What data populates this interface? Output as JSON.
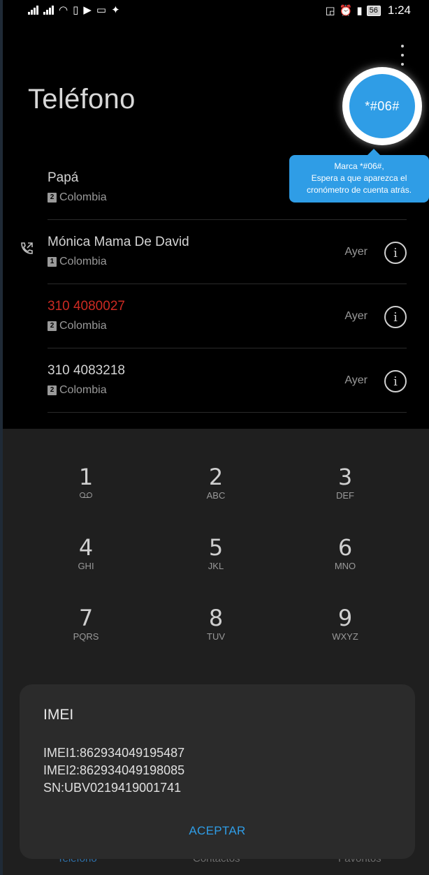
{
  "status_bar": {
    "battery": "56",
    "time": "1:24"
  },
  "app": {
    "title": "Teléfono"
  },
  "highlight": {
    "code": "*#06#",
    "tooltip": [
      "Marca *#06#,",
      "Espera a que aparezca el",
      "cronómetro de cuenta atrás."
    ]
  },
  "call_log": [
    {
      "name": "Papá",
      "sim": "2",
      "location": "Colombia",
      "when": "",
      "missed": false
    },
    {
      "name": "Mónica Mama De David",
      "sim": "1",
      "location": "Colombia",
      "when": "Ayer",
      "missed": false
    },
    {
      "name": "310 4080027",
      "sim": "2",
      "location": "Colombia",
      "when": "Ayer",
      "missed": true
    },
    {
      "name": "310 4083218",
      "sim": "2",
      "location": "Colombia",
      "when": "Ayer",
      "missed": false
    }
  ],
  "dialpad": [
    {
      "digit": "1",
      "letters": ""
    },
    {
      "digit": "2",
      "letters": "ABC"
    },
    {
      "digit": "3",
      "letters": "DEF"
    },
    {
      "digit": "4",
      "letters": "GHI"
    },
    {
      "digit": "5",
      "letters": "JKL"
    },
    {
      "digit": "6",
      "letters": "MNO"
    },
    {
      "digit": "7",
      "letters": "PQRS"
    },
    {
      "digit": "8",
      "letters": "TUV"
    },
    {
      "digit": "9",
      "letters": "WXYZ"
    }
  ],
  "bottom_tabs": [
    "Teléfono",
    "Contactos",
    "Favoritos"
  ],
  "imei_dialog": {
    "title": "IMEI",
    "imei1": "IMEI1:862934049195487",
    "imei2": "IMEI2:862934049198085",
    "sn": "SN:UBV0219419001741",
    "accept": "ACEPTAR"
  },
  "colors": {
    "accent": "#2f9de6",
    "missed": "#cc2a22"
  }
}
